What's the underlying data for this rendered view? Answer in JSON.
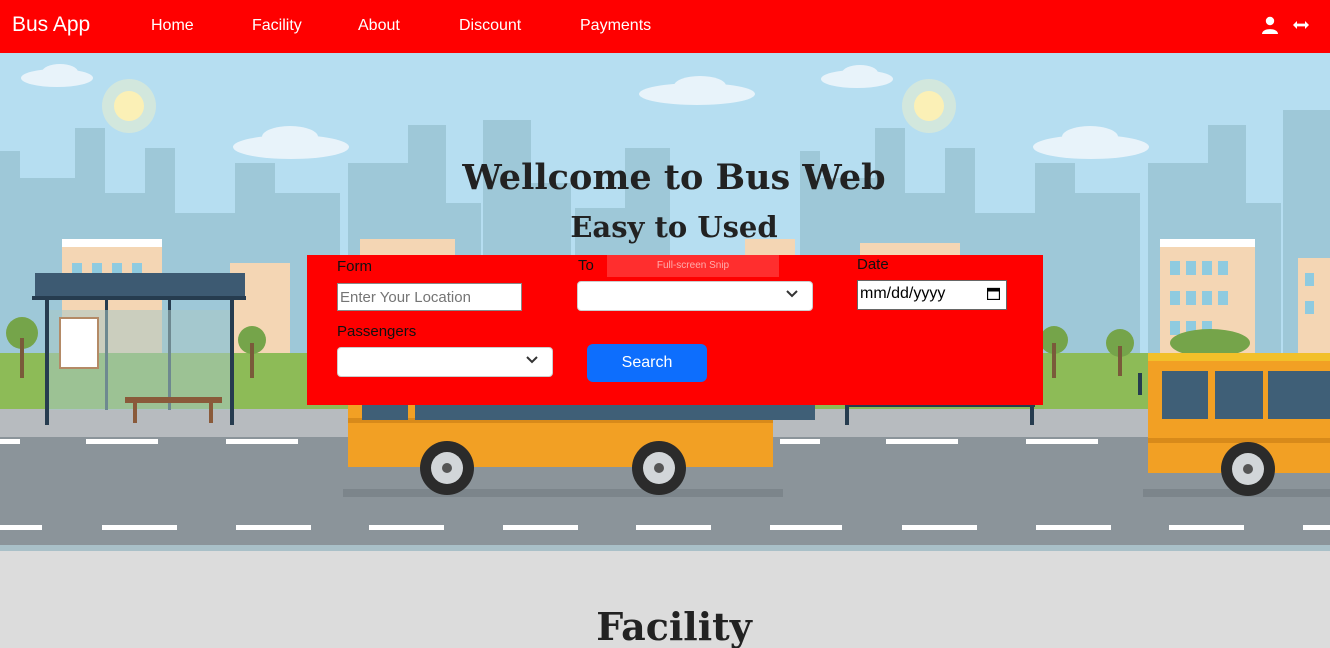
{
  "navbar": {
    "brand": "Bus App",
    "links": [
      "Home",
      "Facility",
      "About",
      "Discount",
      "Payments"
    ],
    "icons": [
      "user-icon",
      "swap-arrows-icon"
    ],
    "color": "#ff0000"
  },
  "hero": {
    "title": "Wellcome to Bus Web",
    "subtitle": "Easy to Used"
  },
  "search_form": {
    "from_label": "Form",
    "from_placeholder": "Enter Your Location",
    "to_label": "To",
    "to_value": "",
    "date_label": "Date",
    "date_placeholder": "mm/dd/yyyy",
    "passengers_label": "Passengers",
    "passengers_value": "",
    "search_button": "Search",
    "overlay_tooltip": "Full-screen Snip",
    "accent": "#0d6efd",
    "background": "#ff0000"
  },
  "facility": {
    "title": "Facility"
  }
}
